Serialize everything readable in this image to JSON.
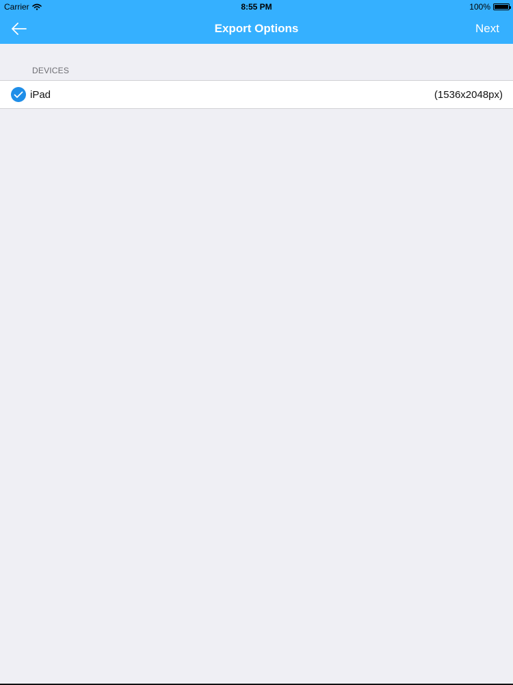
{
  "status_bar": {
    "carrier": "Carrier",
    "time": "8:55 PM",
    "battery": "100%"
  },
  "nav": {
    "title": "Export Options",
    "next_label": "Next",
    "back_icon": "arrow-left-icon"
  },
  "devices": {
    "section_title": "DEVICES",
    "items": [
      {
        "label": "iPad",
        "resolution": "(1536x2048px)",
        "selected": true
      }
    ]
  },
  "colors": {
    "accent": "#35b0ff",
    "check": "#1f8ee8",
    "background": "#efeff4"
  }
}
